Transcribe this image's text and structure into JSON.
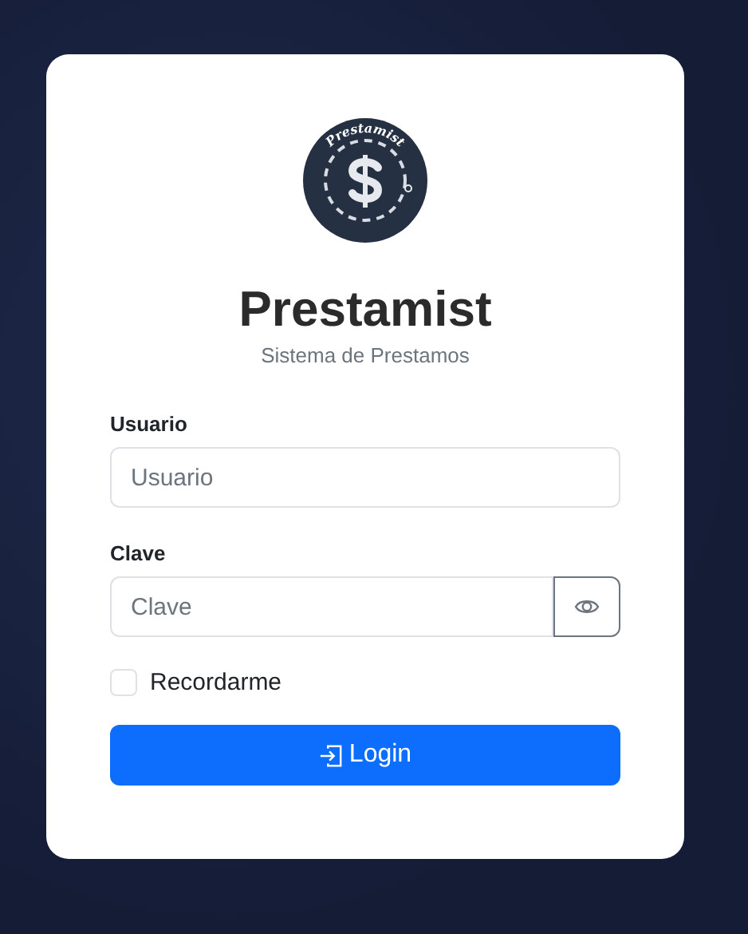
{
  "logo": {
    "text": "Prestamist"
  },
  "title": "Prestamist",
  "subtitle": "Sistema de Prestamos",
  "fields": [
    {
      "label": "Usuario",
      "placeholder": "Usuario",
      "kind": "text"
    },
    {
      "label": "Clave",
      "placeholder": "Clave",
      "kind": "password"
    }
  ],
  "remember": {
    "label": "Recordarme",
    "checked": false
  },
  "login_button": "Login"
}
